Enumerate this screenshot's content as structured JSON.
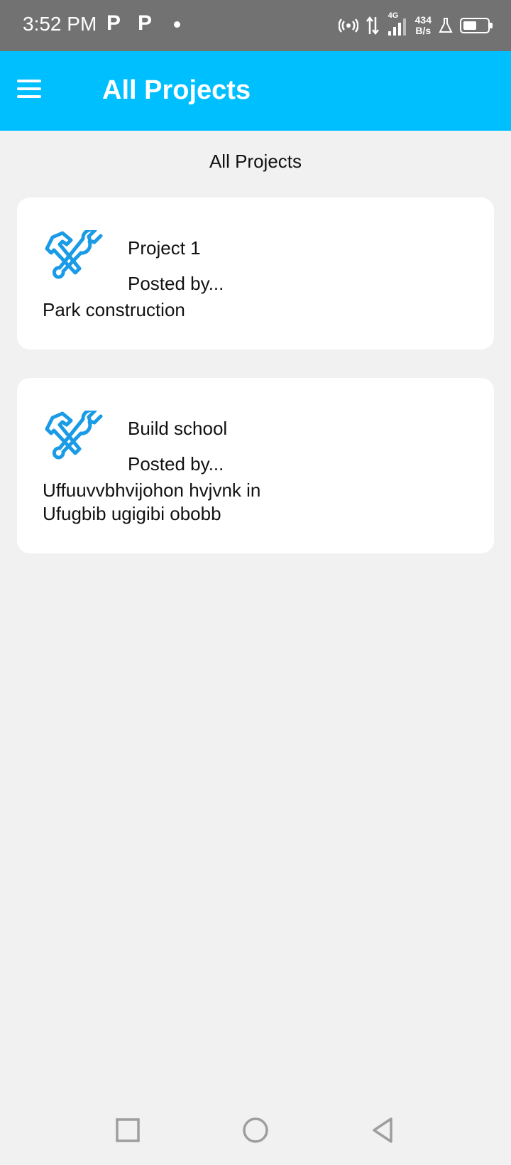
{
  "status_bar": {
    "time": "3:52 PM",
    "app_icon_1": "P",
    "app_icon_2": "P",
    "network": "4G",
    "speed_value": "434",
    "speed_unit": "B/s"
  },
  "app_bar": {
    "title": "All Projects",
    "menu_icon": "hamburger-icon"
  },
  "page": {
    "heading": "All Projects"
  },
  "projects": [
    {
      "title": "Project 1",
      "posted_by": "Posted by...",
      "description": "Park construction",
      "icon": "tools-icon"
    },
    {
      "title": "Build school",
      "posted_by": "Posted by...",
      "description": "Uffuuvvbhvijohon hvjvnk in Ufugbib ugigibi obobb",
      "icon": "tools-icon"
    }
  ],
  "colors": {
    "app_bar": "#00bfff",
    "status_bar": "#727272",
    "icon": "#1a9be6",
    "background": "#f1f1f1"
  }
}
